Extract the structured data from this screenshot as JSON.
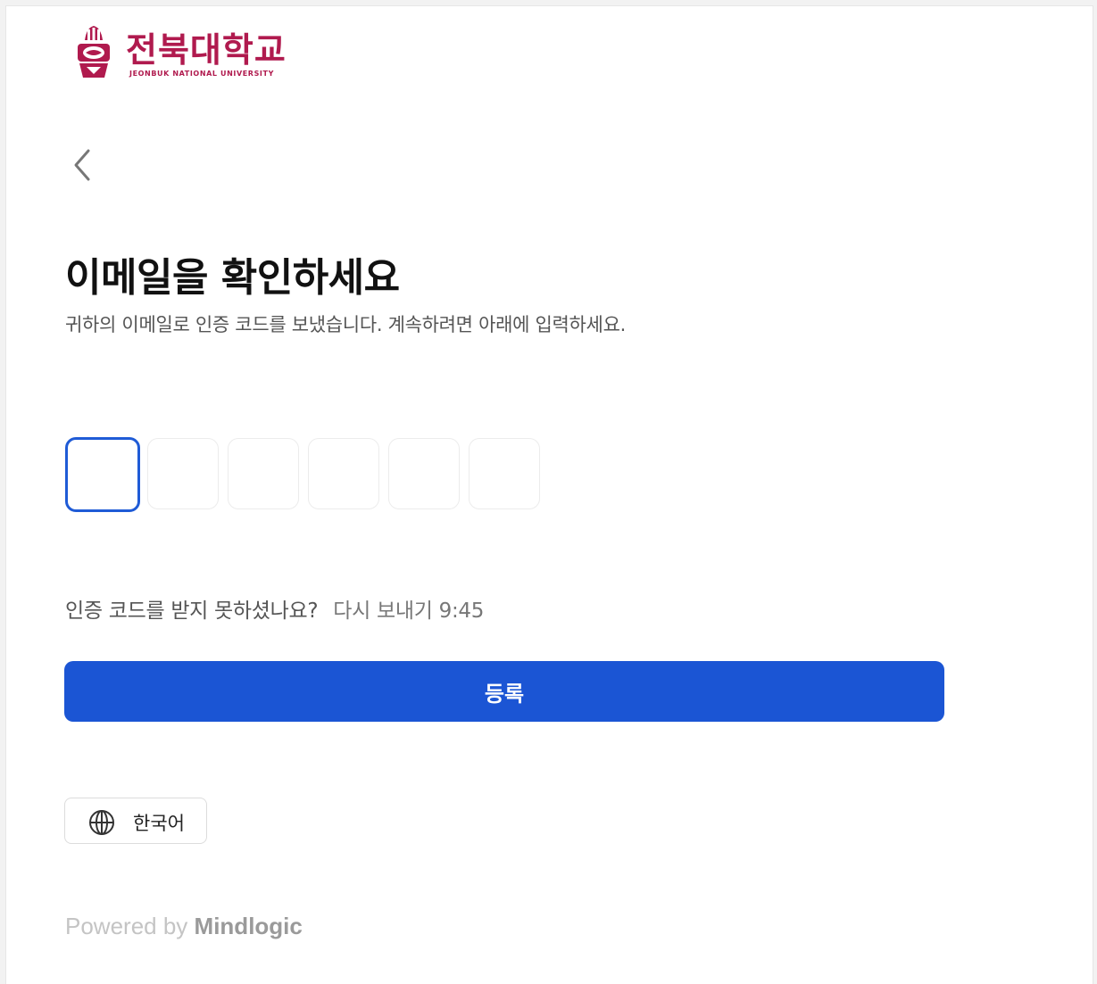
{
  "logo": {
    "name_ko": "전북대학교",
    "name_en": "JEONBUK NATIONAL UNIVERSITY",
    "brand_color": "#b01a4e"
  },
  "nav": {
    "back_icon": "chevron-left-icon"
  },
  "page": {
    "title": "이메일을 확인하세요",
    "subtitle": "귀하의 이메일로 인증 코드를 보냈습니다. 계속하려면 아래에 입력하세요."
  },
  "code": {
    "length": 6,
    "digits": [
      "",
      "",
      "",
      "",
      "",
      ""
    ],
    "active_index": 0,
    "focus_color": "#1f5bd6"
  },
  "resend": {
    "question": "인증 코드를 받지 못하셨나요?",
    "link_label": "다시 보내기",
    "countdown": "9:45"
  },
  "submit": {
    "label": "등록",
    "color": "#1b55d4"
  },
  "language": {
    "icon": "globe-icon",
    "label": "한국어"
  },
  "footer": {
    "powered_prefix": "Powered by",
    "powered_brand": "Mindlogic"
  }
}
